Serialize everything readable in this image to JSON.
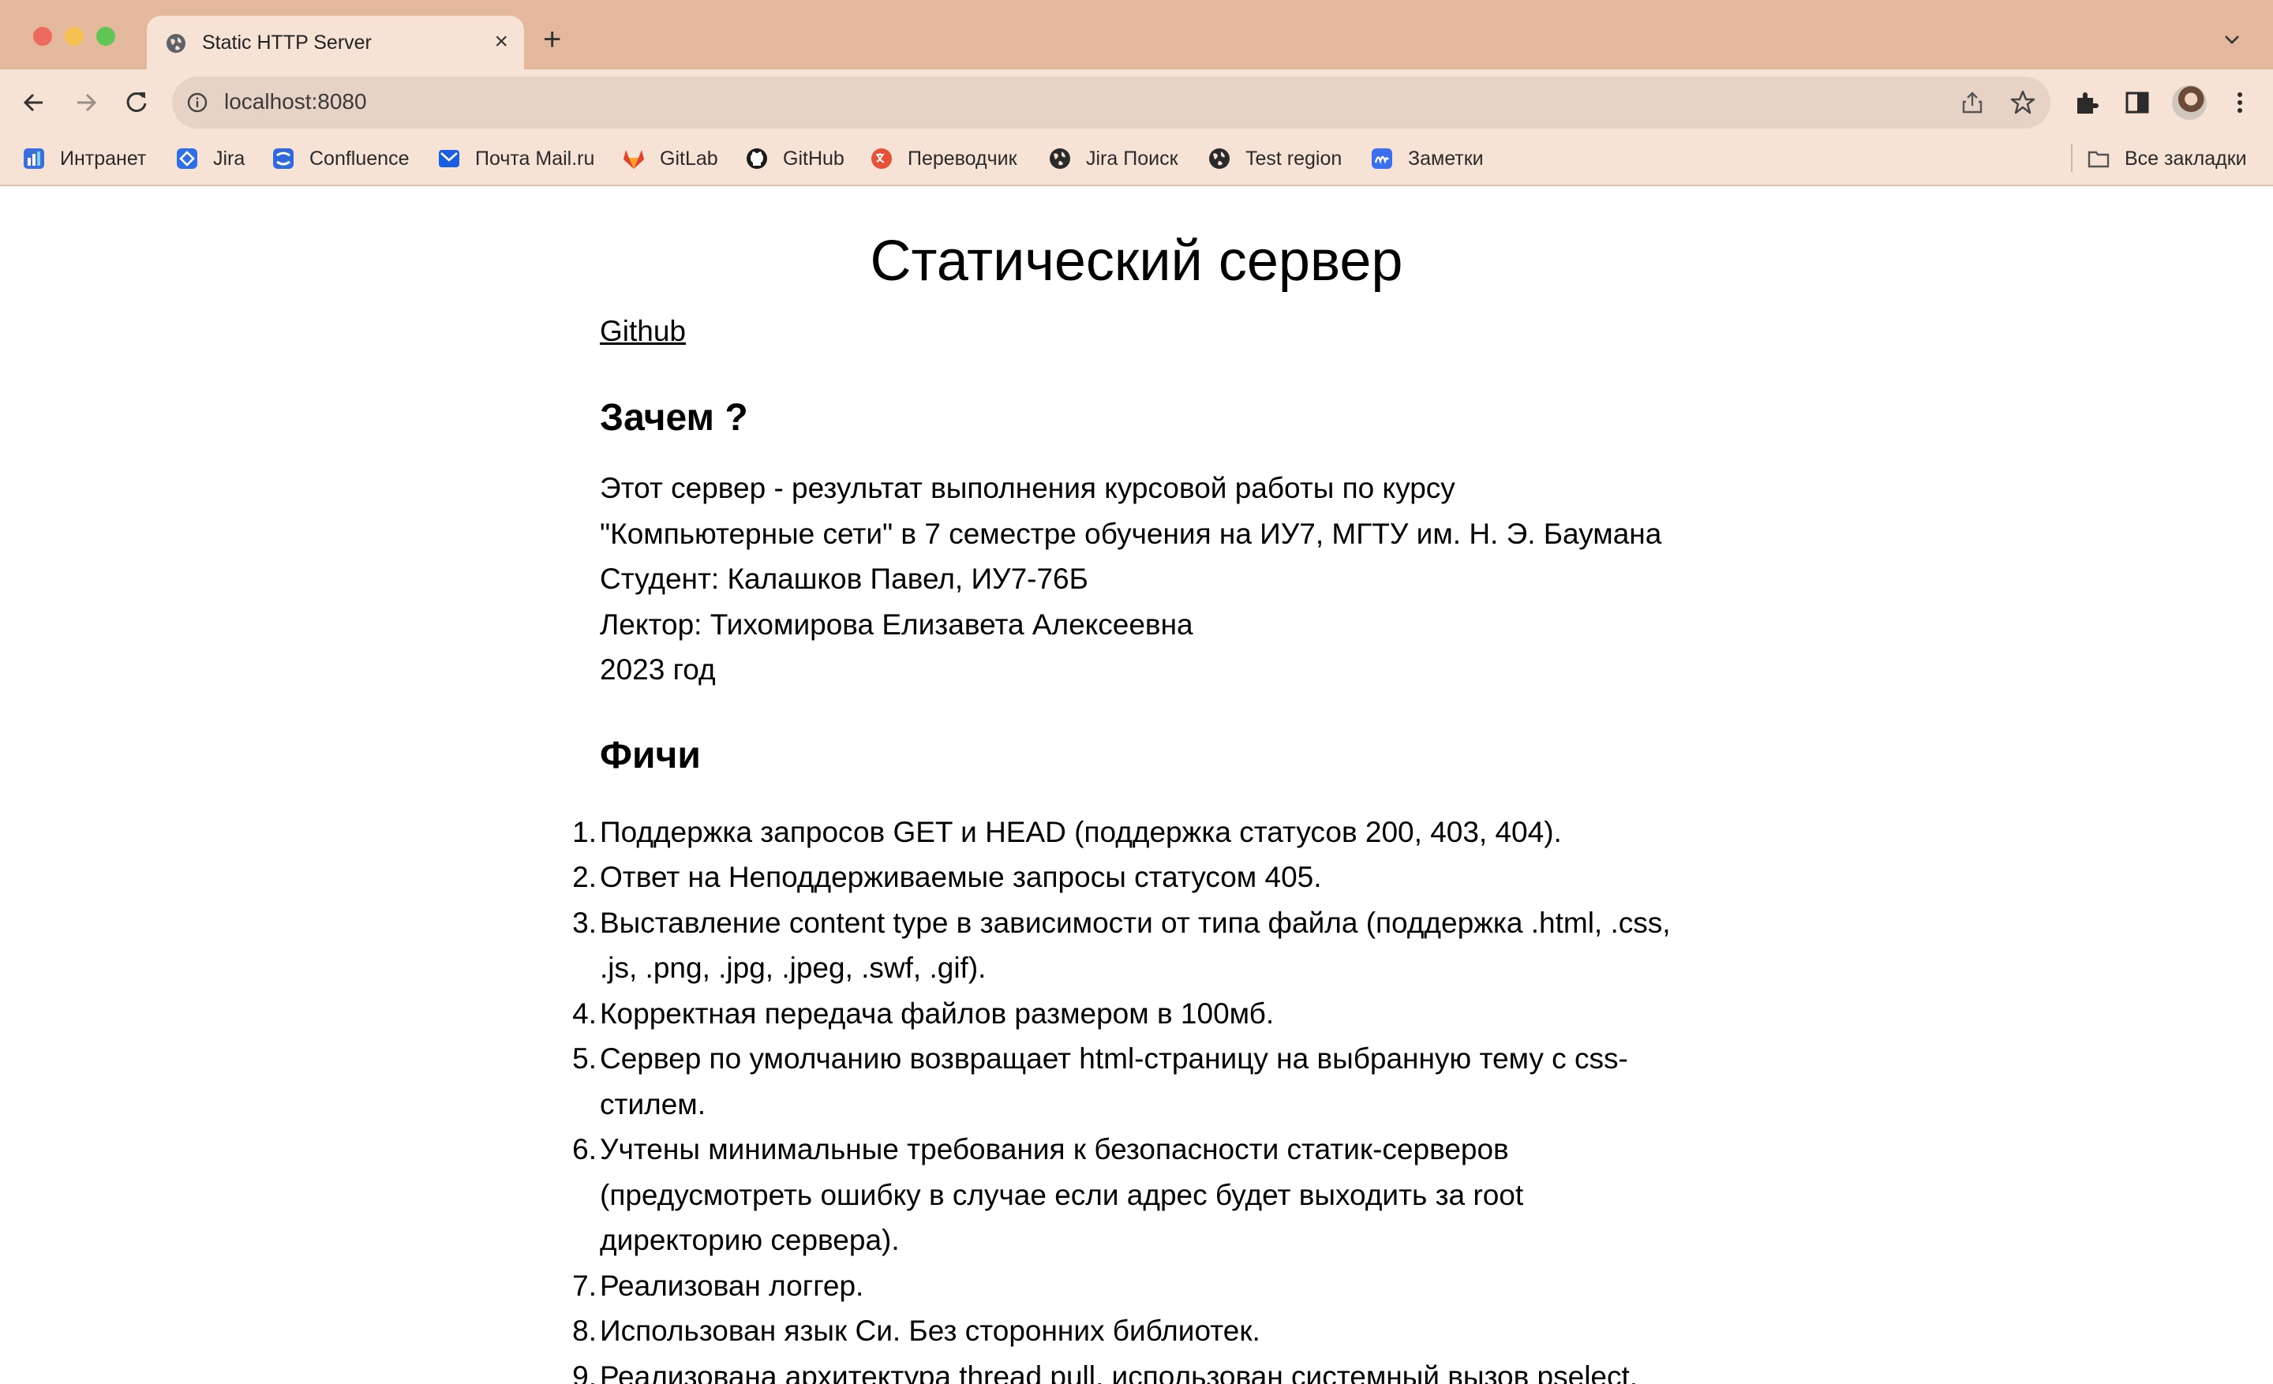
{
  "browser": {
    "tab": {
      "title": "Static HTTP Server"
    },
    "address_bar": {
      "url": "localhost:8080"
    },
    "bookmarks": [
      {
        "label": "Интранет",
        "icon": "intranet-icon"
      },
      {
        "label": "Jira",
        "icon": "jira-icon"
      },
      {
        "label": "Confluence",
        "icon": "confluence-icon"
      },
      {
        "label": "Почта Mail.ru",
        "icon": "mail-icon"
      },
      {
        "label": "GitLab",
        "icon": "gitlab-icon"
      },
      {
        "label": "GitHub",
        "icon": "github-icon"
      },
      {
        "label": "Переводчик",
        "icon": "translator-icon"
      },
      {
        "label": "Jira Поиск",
        "icon": "globe-icon"
      },
      {
        "label": "Test region",
        "icon": "globe-icon"
      },
      {
        "label": "Заметки",
        "icon": "notes-icon"
      }
    ],
    "all_bookmarks": {
      "label": "Все закладки",
      "icon": "folder-icon"
    }
  },
  "page": {
    "title": "Статический сервер",
    "github_link": "Github",
    "why_heading": "Зачем ?",
    "why_lines": [
      "Этот сервер - результат выполнения курсовой работы по курсу",
      "\"Компьютерные сети\" в 7 семестре обучения на ИУ7, МГТУ им. Н. Э. Баумана",
      "Студент: Калашков Павел, ИУ7-76Б",
      "Лектор: Тихомирова Елизавета Алексеевна",
      "2023 год"
    ],
    "features_heading": "Фичи",
    "features": [
      {
        "num": "1.",
        "lines": [
          "Поддержка запросов GET и HEAD (поддержка статусов 200, 403, 404)."
        ]
      },
      {
        "num": "2.",
        "lines": [
          "Ответ на Неподдерживаемые запросы статусом 405."
        ]
      },
      {
        "num": "3.",
        "lines": [
          "Выставление content type в зависимости от типа файла (поддержка .html, .css,",
          ".js, .png, .jpg, .jpeg, .swf, .gif)."
        ]
      },
      {
        "num": "4.",
        "lines": [
          "Корректная передача файлов размером в 100мб."
        ]
      },
      {
        "num": "5.",
        "lines": [
          "Сервер по умолчанию возвращает html-страницу на выбранную тему с css-",
          "стилем."
        ]
      },
      {
        "num": "6.",
        "lines": [
          "Учтены минимальные требования к безопасности статик-серверов",
          "(предусмотреть ошибку в случае если адрес будет выходить за root",
          "директорию сервера)."
        ]
      },
      {
        "num": "7.",
        "lines": [
          "Реализован логгер."
        ]
      },
      {
        "num": "8.",
        "lines": [
          "Использован язык Си. Без сторонних библиотек."
        ]
      },
      {
        "num": "9.",
        "lines": [
          "Реализована архитектура thread pull, использован системный вызов pselect."
        ]
      }
    ]
  }
}
